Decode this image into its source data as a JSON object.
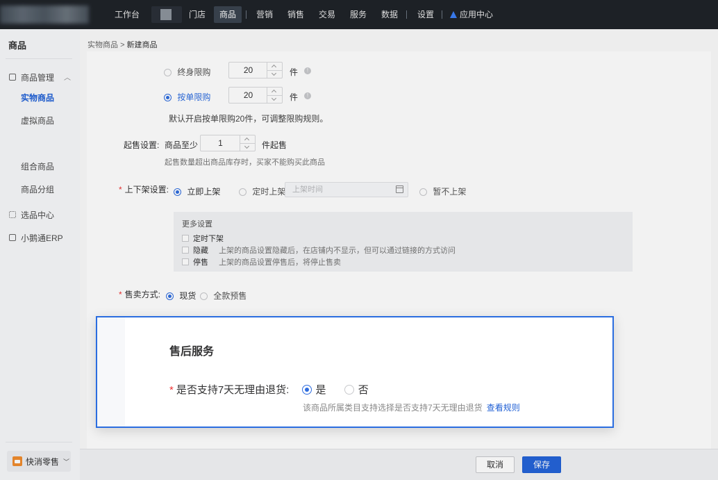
{
  "topnav": {
    "items": [
      {
        "label": "工作台"
      },
      {
        "label": "门店"
      },
      {
        "label": "商品"
      },
      {
        "label": "营销"
      },
      {
        "label": "销售"
      },
      {
        "label": "交易"
      },
      {
        "label": "服务"
      },
      {
        "label": "数据"
      },
      {
        "label": "设置"
      },
      {
        "label": "应用中心"
      }
    ],
    "active": "商品"
  },
  "sidebar": {
    "title": "商品",
    "group": "商品管理",
    "items": [
      {
        "label": "实物商品"
      },
      {
        "label": "虚拟商品"
      },
      {
        "label": "组合商品"
      },
      {
        "label": "商品分组"
      }
    ],
    "extra": [
      {
        "label": "选品中心"
      },
      {
        "label": "小鹅通ERP"
      }
    ],
    "shop": "快消零售"
  },
  "breadcrumb": {
    "parent": "实物商品",
    "sep": ">",
    "current": "新建商品"
  },
  "limit": {
    "lifetime_label": "终身限购",
    "lifetime_value": "20",
    "per_order_label": "按单限购",
    "per_order_value": "20",
    "unit": "件",
    "note": "默认开启按单限购20件，可调整限购规则。"
  },
  "min_sale": {
    "label": "起售设置:",
    "prefix": "商品至少",
    "value": "1",
    "suffix": "件起售",
    "note": "起售数量超出商品库存时，买家不能购买此商品"
  },
  "shelf": {
    "label": "上下架设置:",
    "immediate": "立即上架",
    "scheduled": "定时上架",
    "date_placeholder": "上架时间",
    "none": "暂不上架"
  },
  "more": {
    "title": "更多设置",
    "options": [
      {
        "label": "定时下架",
        "desc": ""
      },
      {
        "label": "隐藏",
        "desc": "上架的商品设置隐藏后，在店铺内不显示，但可以通过链接的方式访问"
      },
      {
        "label": "停售",
        "desc": "上架的商品设置停售后，将停止售卖"
      }
    ]
  },
  "sale_mode": {
    "label": "售卖方式:",
    "spot": "现货",
    "presale": "全款预售"
  },
  "after_sale": {
    "title": "售后服务",
    "question": "是否支持7天无理由退货:",
    "yes": "是",
    "no": "否",
    "hint": "该商品所属类目支持选择是否支持7天无理由退货",
    "link": "查看规则"
  },
  "footer": {
    "cancel": "取消",
    "save": "保存"
  },
  "colors": {
    "primary": "#2d6cdf",
    "nav_bg": "#1f2329",
    "required": "#e33333"
  }
}
